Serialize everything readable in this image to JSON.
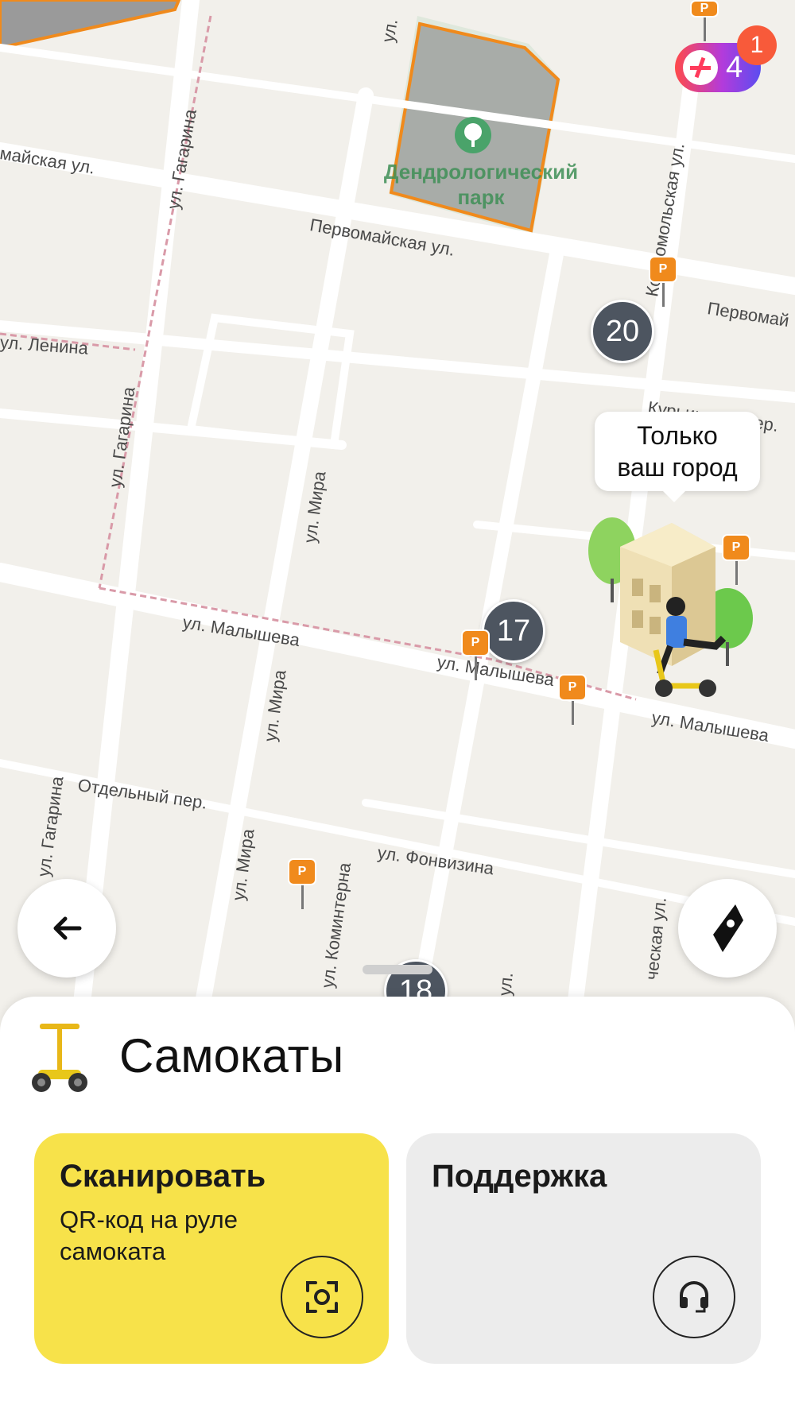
{
  "map": {
    "streets": [
      "майская ул.",
      "Первомайская ул.",
      "Первомай",
      "ул. Ленина",
      "ул. Гагарина",
      "ул. Гагарина",
      "ул. Гагарина",
      "ул. Мира",
      "ул. Мира",
      "ул. Мира",
      "ул. Малышева",
      "ул. Малышева",
      "ул. Малышева",
      "Отдельный пер.",
      "ул. Фонвизина",
      "ул. Коминтерна",
      "Комсомольская ул.",
      "Курьинский пер.",
      "ул.",
      "ческая ул.",
      "ул."
    ],
    "park": {
      "name_line1": "Дендрологический",
      "name_line2": "парк"
    },
    "clusters": [
      "20",
      "17",
      "18"
    ],
    "pin_label": "P"
  },
  "tooltip": {
    "line1": "Только",
    "line2": "ваш город"
  },
  "plus": {
    "count": "4",
    "notification_count": "1"
  },
  "sheet": {
    "title": "Самокаты",
    "scan": {
      "title": "Сканировать",
      "subtitle": "QR-код на руле самоката"
    },
    "support": {
      "title": "Поддержка"
    }
  },
  "colors": {
    "accent_yellow": "#f7e24a",
    "pin_orange": "#f08a1c",
    "cluster": "#4d5560"
  },
  "icons": [
    "back-arrow-icon",
    "navigation-arrow-icon",
    "scooter-icon",
    "qr-scan-icon",
    "headset-icon",
    "plus-icon",
    "tree-icon"
  ]
}
